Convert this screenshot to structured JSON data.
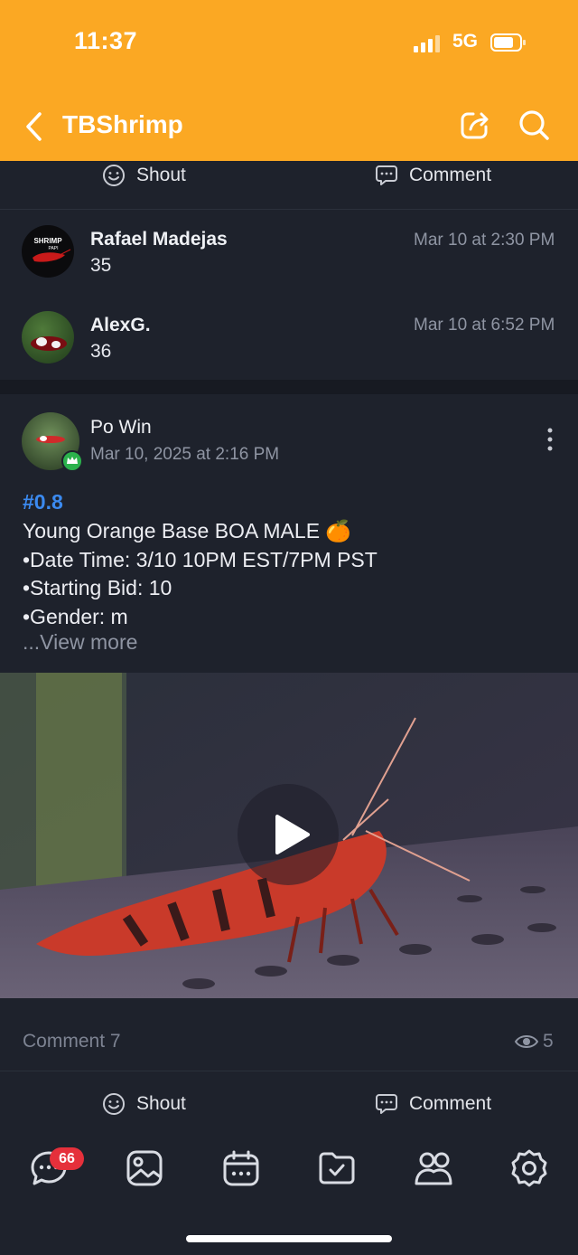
{
  "status_bar": {
    "time": "11:37",
    "network": "5G"
  },
  "nav": {
    "title": "TBShrimp"
  },
  "top_actions": {
    "shout": "Shout",
    "comment": "Comment"
  },
  "comments": [
    {
      "name": "Rafael Madejas",
      "value": "35",
      "time": "Mar 10 at 2:30 PM",
      "avatar_text": "SHRIMP PAPI"
    },
    {
      "name": "AlexG.",
      "value": "36",
      "time": "Mar 10 at 6:52 PM"
    }
  ],
  "post": {
    "author": "Po Win",
    "date": "Mar 10, 2025 at 2:16 PM",
    "tag": "#0.8",
    "lines": [
      "Young Orange Base BOA MALE 🍊",
      "•Date Time: 3/10 10PM EST/7PM PST",
      "•Starting Bid: 10",
      "•Gender: m"
    ],
    "view_more": "...View more",
    "comment_count": "Comment 7",
    "views": "5"
  },
  "bottom_actions": {
    "shout": "Shout",
    "comment": "Comment"
  },
  "tabbar": {
    "badge": "66",
    "icons": [
      "chat-icon",
      "image-icon",
      "calendar-icon",
      "folder-check-icon",
      "people-icon",
      "gear-icon"
    ]
  },
  "colors": {
    "header": "#fba823",
    "background": "#1e222c",
    "link": "#3b8af0",
    "badge": "#e5303b"
  }
}
